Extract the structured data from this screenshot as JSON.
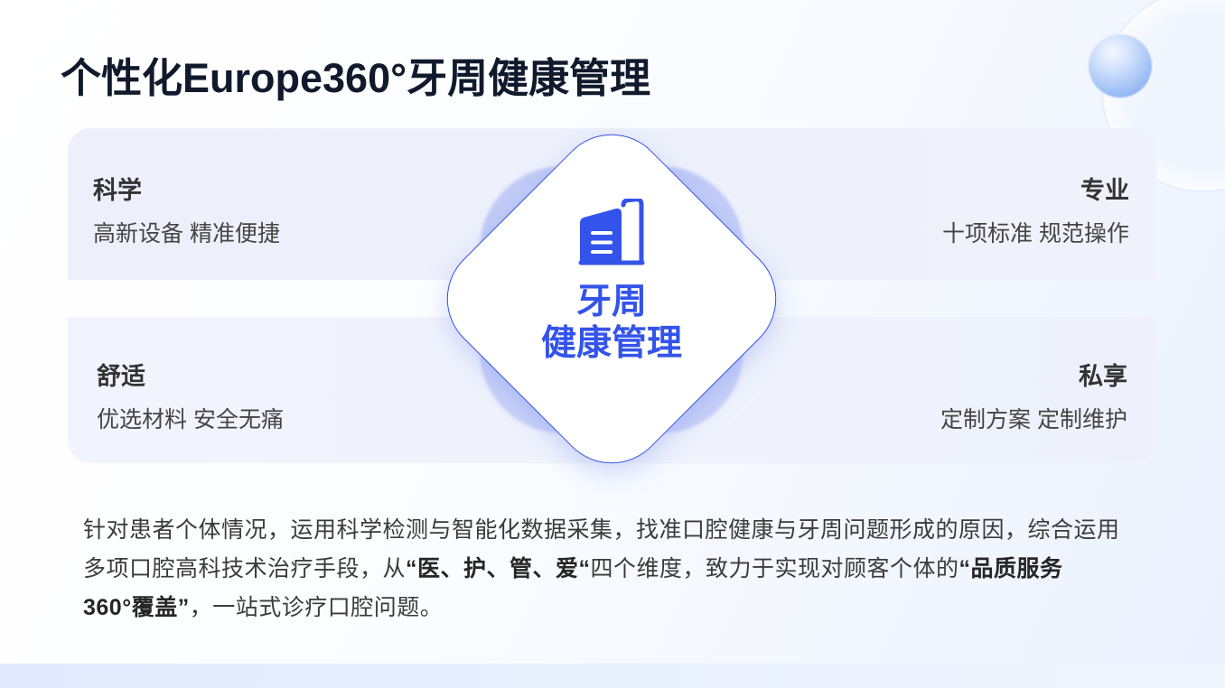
{
  "title": "个性化Europe360°牙周健康管理",
  "center": {
    "icon": "building-icon",
    "title_line1": "牙周",
    "title_line2": "健康管理"
  },
  "quadrants": [
    {
      "label": "科学",
      "description": "高新设备 精准便捷"
    },
    {
      "label": "专业",
      "description": "十项标准 规范操作"
    },
    {
      "label": "舒适",
      "description": "优选材料 安全无痛"
    },
    {
      "label": "私享",
      "description": "定制方案 定制维护"
    }
  ],
  "description": {
    "lines": [
      [
        "针对患者个体情况，运用科学检测与智能化数据采集，找准口腔健康与牙周问题形成的原因，综合运用"
      ],
      [
        "多项口腔高科技术治疗手段，从",
        "“医、护、管、爱“",
        "四个维度，致力于实现对顾客个体的",
        "“品质服务"
      ],
      [
        "360°覆盖”",
        "，一站式诊疗口腔问题。"
      ]
    ]
  },
  "colors": {
    "title_text": "#111a2c",
    "accent_blue": "#3453ea",
    "diamond_border": "#3350e8",
    "glow_backdrop": "#c4cdf7",
    "label_text": "#333333",
    "body_text": "#3b3b3b"
  }
}
